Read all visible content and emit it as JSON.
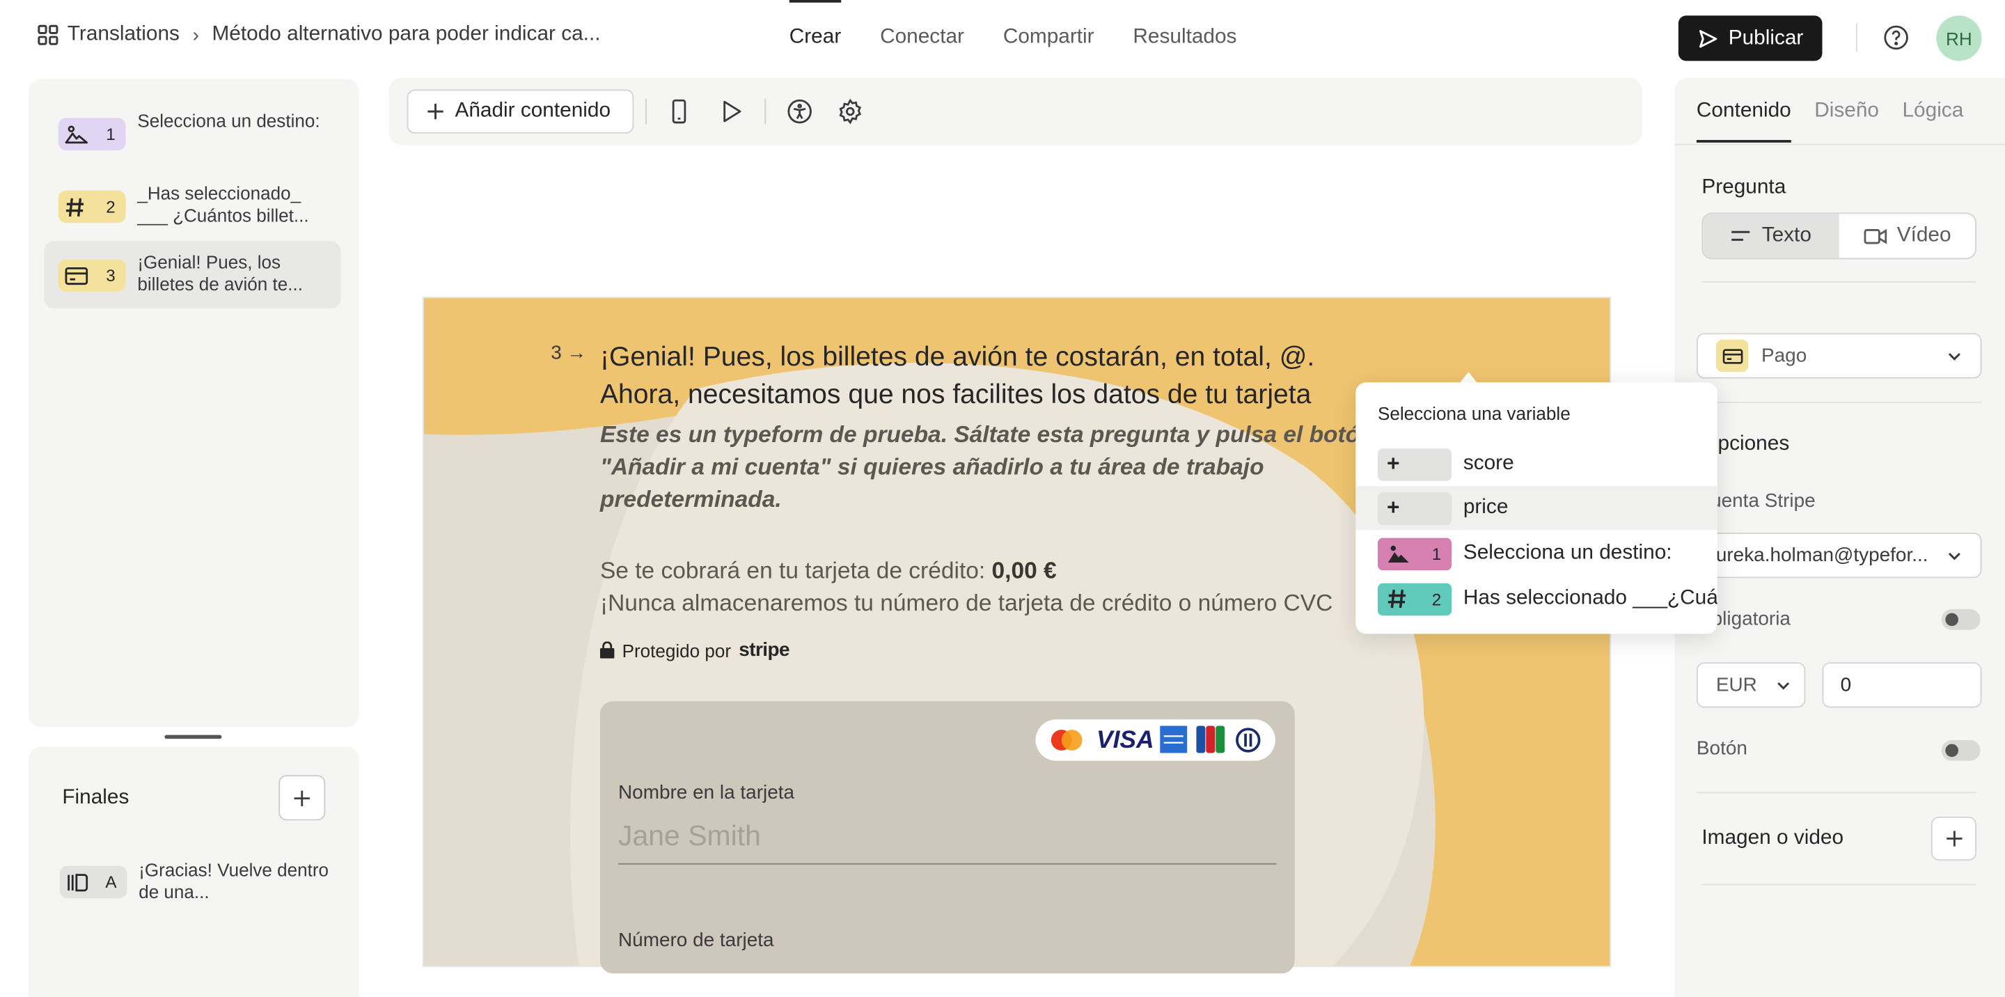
{
  "breadcrumb": {
    "root": "Translations",
    "current": "Método alternativo para poder indicar ca..."
  },
  "nav": {
    "tabs": [
      "Crear",
      "Conectar",
      "Compartir",
      "Resultados"
    ],
    "active": "Crear"
  },
  "header": {
    "publish_label": "Publicar",
    "avatar_initials": "RH"
  },
  "questions": [
    {
      "num": "1",
      "text": "Selecciona un destino:",
      "icon": "image-icon",
      "color": "#e1d5f4"
    },
    {
      "num": "2",
      "text": "_Has seleccionado_ ___ ¿Cuántos billet...",
      "icon": "hash-icon",
      "color": "#f4e29c"
    },
    {
      "num": "3",
      "text": "¡Genial! Pues, los billetes de avión te...",
      "icon": "card-icon",
      "color": "#f4e29c"
    }
  ],
  "endings": {
    "title": "Finales",
    "items": [
      {
        "letter": "A",
        "text": "¡Gracias! Vuelve dentro de una..."
      }
    ]
  },
  "toolbar": {
    "add_content_label": "Añadir contenido"
  },
  "canvas": {
    "question_number": "3",
    "title_line1": "¡Genial! Pues, los billetes de avión te costarán, en total, @.",
    "title_line2": "Ahora, necesitamos que nos facilites los datos de tu tarjeta",
    "description": "Este es un typeform de prueba. Sáltate esta pregunta y pulsa el botón \"Añadir a mi cuenta\" si quieres añadirlo a tu área de trabajo predeterminada.",
    "charge_prefix": "Se te cobrará en tu tarjeta de crédito: ",
    "charge_amount": "0,00 €",
    "never_store": "¡Nunca almacenaremos tu número de tarjeta de crédito o número CVC",
    "protected_by": "Protegido por",
    "stripe": "stripe",
    "card_logo_visa": "VISA",
    "name_label": "Nombre en la tarjeta",
    "name_placeholder": "Jane Smith",
    "card_number_label": "Número de tarjeta"
  },
  "variable_popover": {
    "title": "Selecciona una variable",
    "items": [
      {
        "badge": "+",
        "label": "score",
        "color": "#e2e2e0"
      },
      {
        "badge": "+",
        "label": "price",
        "color": "#e2e2e0"
      },
      {
        "badge": "1",
        "label": "Selecciona un destino:",
        "color": "#d67fb1"
      },
      {
        "badge": "2",
        "label": "Has seleccionado ___¿Cuántos",
        "color": "#5fcab9"
      }
    ]
  },
  "right_panel": {
    "tabs": [
      "Contenido",
      "Diseño",
      "Lógica"
    ],
    "active_tab": "Contenido",
    "pregunta_label": "Pregunta",
    "text_option": "Texto",
    "video_option": "Vídeo",
    "question_type": "Pago",
    "opciones_label": "Opciones",
    "stripe_account_label": "Cuenta Stripe",
    "stripe_account_value": "ureka.holman@typefor...",
    "required_label": "Obligatoria",
    "currency": "EUR",
    "amount": "0",
    "button_label": "Botón",
    "media_label": "Imagen o video"
  }
}
